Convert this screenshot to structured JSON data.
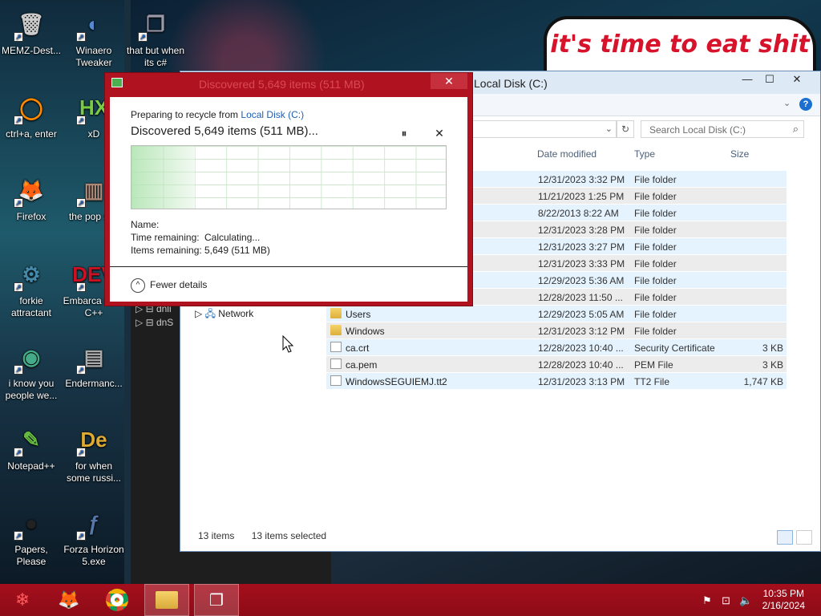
{
  "desktop": {
    "meme_text": "it's time to eat shit",
    "icons": [
      {
        "name": "memz-icon",
        "label": "MEMZ-Dest...",
        "glyph": "🗑"
      },
      {
        "name": "winaero-icon",
        "label": "Winaero Tweaker",
        "glyph": "◐"
      },
      {
        "name": "copy-icon",
        "label": "that but when its c#",
        "glyph": "❐"
      },
      {
        "name": "ctrl-a-icon",
        "label": "ctrl+a, enter",
        "glyph": "◯"
      },
      {
        "name": "hxd-icon",
        "label": "xD",
        "glyph": "HX"
      },
      {
        "name": "firefox-icon",
        "label": "Firefox",
        "glyph": "🦊"
      },
      {
        "name": "popshit-icon",
        "label": "the pop shit",
        "glyph": "▥"
      },
      {
        "name": "forkie-icon",
        "label": "forkie attractant",
        "glyph": "⚙"
      },
      {
        "name": "devcpp-icon",
        "label": "Embarca Dev-C++",
        "glyph": "DEV"
      },
      {
        "name": "chrome-icon",
        "label": "i know you people we...",
        "glyph": "◉"
      },
      {
        "name": "enderman-icon",
        "label": "Endermanc...",
        "glyph": "▤"
      },
      {
        "name": "notepadpp-icon",
        "label": "Notepad++",
        "glyph": "✎"
      },
      {
        "name": "de-icon",
        "label": "for when some russi...",
        "glyph": "De"
      },
      {
        "name": "papers-icon",
        "label": "Papers, Please",
        "glyph": "●"
      },
      {
        "name": "flash-icon",
        "label": "Forza Horizon 5.exe",
        "glyph": "ƒ"
      }
    ]
  },
  "dark_window": {
    "rows": [
      "dnli",
      "dnS"
    ]
  },
  "explorer": {
    "title": "Local Disk (C:)",
    "search_placeholder": "Search Local Disk (C:)",
    "columns": {
      "date": "Date modified",
      "type": "Type",
      "size": "Size"
    },
    "nav_network": "Network",
    "files": [
      {
        "name": "",
        "date": "12/31/2023 3:32 PM",
        "type": "File folder",
        "size": "",
        "kind": "folder"
      },
      {
        "name": "",
        "date": "11/21/2023 1:25 PM",
        "type": "File folder",
        "size": "",
        "kind": "folder"
      },
      {
        "name": "",
        "date": "8/22/2013 8:22 AM",
        "type": "File folder",
        "size": "",
        "kind": "folder"
      },
      {
        "name": "",
        "date": "12/31/2023 3:28 PM",
        "type": "File folder",
        "size": "",
        "kind": "folder"
      },
      {
        "name": "",
        "date": "12/31/2023 3:27 PM",
        "type": "File folder",
        "size": "",
        "kind": "folder"
      },
      {
        "name": "",
        "date": "12/31/2023 3:33 PM",
        "type": "File folder",
        "size": "",
        "kind": "folder"
      },
      {
        "name": "",
        "date": "12/29/2023 5:36 AM",
        "type": "File folder",
        "size": "",
        "kind": "folder"
      },
      {
        "name": "",
        "date": "12/28/2023 11:50 ...",
        "type": "File folder",
        "size": "",
        "kind": "folder"
      },
      {
        "name": "Users",
        "date": "12/29/2023 5:05 AM",
        "type": "File folder",
        "size": "",
        "kind": "folder"
      },
      {
        "name": "Windows",
        "date": "12/31/2023 3:12 PM",
        "type": "File folder",
        "size": "",
        "kind": "folder"
      },
      {
        "name": "ca.crt",
        "date": "12/28/2023 10:40 ...",
        "type": "Security Certificate",
        "size": "3 KB",
        "kind": "doc"
      },
      {
        "name": "ca.pem",
        "date": "12/28/2023 10:40 ...",
        "type": "PEM File",
        "size": "3 KB",
        "kind": "doc"
      },
      {
        "name": "WindowsSEGUIEMJ.tt2",
        "date": "12/31/2023 3:13 PM",
        "type": "TT2 File",
        "size": "1,747 KB",
        "kind": "doc"
      }
    ],
    "status_items": "13 items",
    "status_selected": "13 items selected"
  },
  "dialog": {
    "title": "Discovered 5,649 items (511 MB)",
    "preparing": "Preparing to recycle from ",
    "source": "Local Disk (C:)",
    "discovered": "Discovered 5,649 items (511 MB)...",
    "name_label": "Name:",
    "time_label": "Time remaining:",
    "time_value": "Calculating...",
    "items_label": "Items remaining:",
    "items_value": "5,649 (511 MB)",
    "fewer_details": "Fewer details",
    "progress_fraction": 0.2
  },
  "taskbar": {
    "time": "10:35 PM",
    "date": "2/16/2024"
  }
}
